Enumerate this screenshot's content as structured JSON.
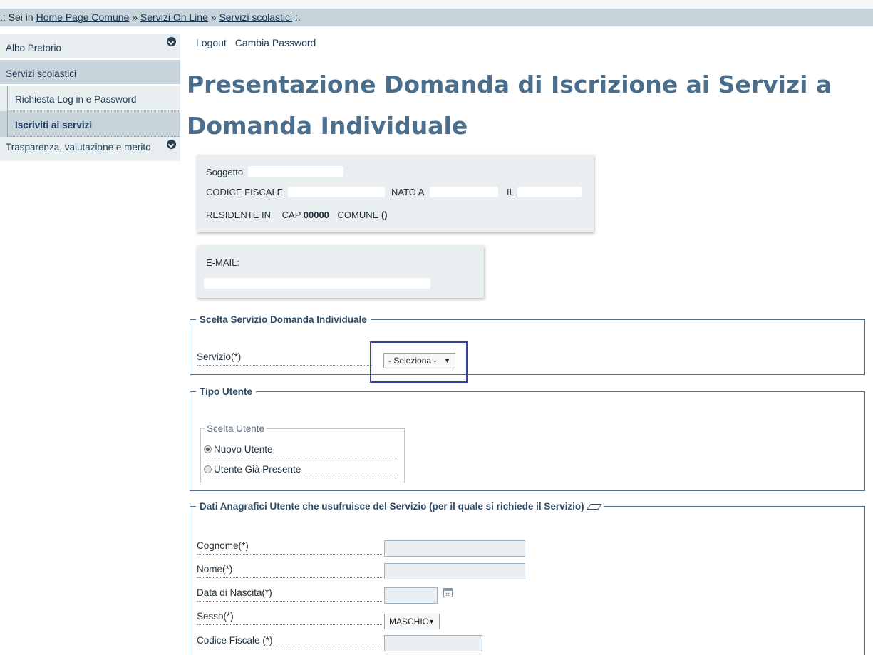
{
  "breadcrumb": {
    "prefix": ".: Sei in",
    "items": [
      "Home Page Comune",
      "Servizi On Line",
      "Servizi scolastici"
    ],
    "separator": "»",
    "suffix": ":."
  },
  "sidebar": {
    "items": [
      {
        "label": "Albo Pretorio"
      },
      {
        "label": "Servizi scolastici"
      },
      {
        "label": "Richiesta Log in e Password"
      },
      {
        "label": "Iscriviti ai servizi"
      },
      {
        "label": "Trasparenza, valutazione e merito"
      }
    ]
  },
  "userlinks": {
    "logout": "Logout",
    "change_password": "Cambia Password"
  },
  "page": {
    "title": "Presentazione Domanda di Iscrizione ai Servizi a Domanda Individuale"
  },
  "subject": {
    "soggetto_label": "Soggetto",
    "cf_label": "CODICE FISCALE",
    "nato_label": "NATO A",
    "il_label": "IL",
    "residente_label": "RESIDENTE IN",
    "cap_label": "CAP",
    "cap_value": "00000",
    "comune_label": "COMUNE",
    "comune_value": "()"
  },
  "email": {
    "label": "E-MAIL:"
  },
  "servizio_section": {
    "legend": "Scelta Servizio Domanda Individuale",
    "label": "Servizio(*)",
    "select_value": "- Seleziona -"
  },
  "tipo_utente": {
    "legend": "Tipo Utente",
    "inner_legend": "Scelta Utente",
    "options": [
      "Nuovo Utente",
      "Utente Già Presente"
    ]
  },
  "anagrafica": {
    "legend": "Dati Anagrafici Utente che usufruisce del Servizio (per il quale si richiede il Servizio)",
    "cognome_label": "Cognome(*)",
    "nome_label": "Nome(*)",
    "nascita_label": "Data di Nascita(*)",
    "sesso_label": "Sesso(*)",
    "sesso_value": "MASCHIO",
    "cf_label": "Codice Fiscale (*)"
  },
  "colors": {
    "accent": "#4a6e8c",
    "sidebar_bg": "#e8edf0",
    "highlight": "#3a3fa8"
  },
  "icons": [
    "plus-circle-icon",
    "calendar-icon",
    "eraser-icon",
    "dropdown-arrow-icon"
  ]
}
